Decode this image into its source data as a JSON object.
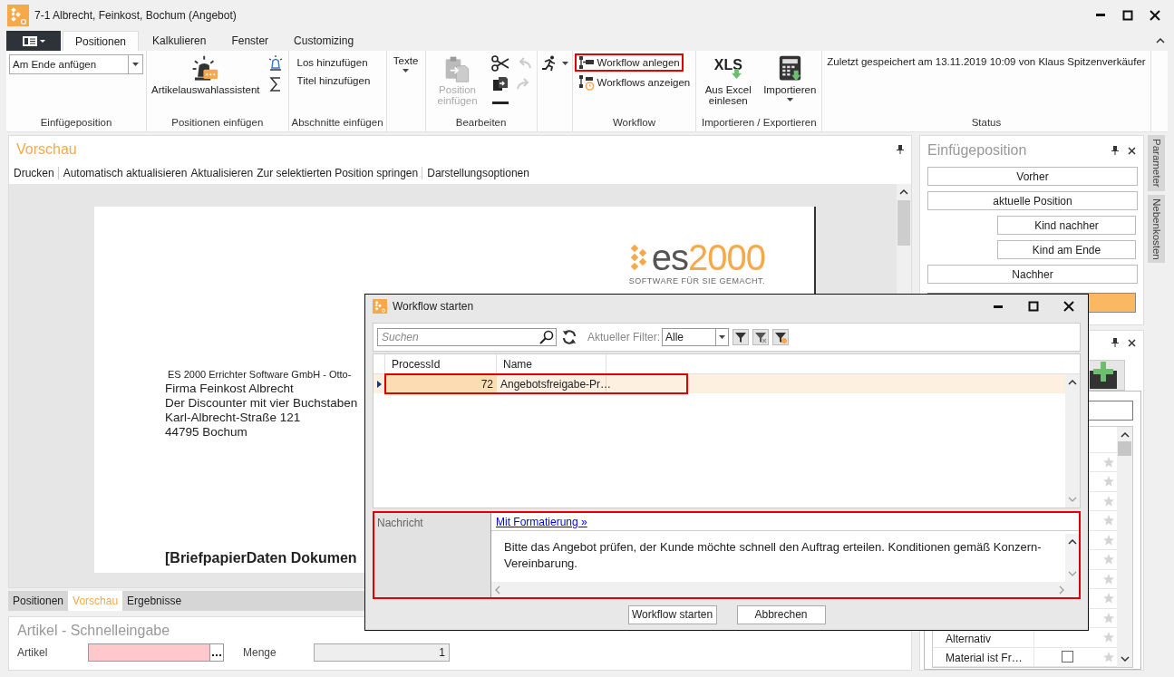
{
  "window": {
    "title": "7-1 Albrecht, Feinkost, Bochum (Angebot)"
  },
  "ribbon_tabs": [
    {
      "label": "Positionen",
      "selected": true
    },
    {
      "label": "Kalkulieren",
      "selected": false
    },
    {
      "label": "Fenster",
      "selected": false
    },
    {
      "label": "Customizing",
      "selected": false
    }
  ],
  "ribbon": {
    "groups": [
      {
        "label": "Einfügeposition",
        "columns": [
          [
            {
              "kind": "dropdown",
              "label": "Am Ende anfügen",
              "disabled": false,
              "highlighted": false
            }
          ]
        ]
      },
      {
        "label": "Positionen einfügen",
        "columns": [
          [
            {
              "kind": "large",
              "label": "Artikelauswahlassistent",
              "disabled": false,
              "highlighted": false
            }
          ],
          [
            {
              "kind": "icon",
              "disabled": false,
              "highlighted": false
            },
            {
              "kind": "icon",
              "disabled": false,
              "highlighted": false
            }
          ]
        ]
      },
      {
        "label": "Abschnitte einfügen",
        "columns": [
          [
            {
              "kind": "text",
              "label": "Los hinzufügen",
              "disabled": false,
              "highlighted": false
            },
            {
              "kind": "text",
              "label": "Titel hinzufügen",
              "disabled": false,
              "highlighted": false
            }
          ]
        ]
      },
      {
        "columns": [
          [
            {
              "kind": "large_menu",
              "label": "Texte",
              "disabled": false,
              "highlighted": false
            }
          ]
        ]
      },
      {
        "label": "Bearbeiten",
        "columns": [
          [
            {
              "kind": "large",
              "label": "Position einfügen",
              "disabled": true,
              "highlighted": false
            }
          ],
          [
            {
              "kind": "icon",
              "disabled": false,
              "highlighted": false
            },
            {
              "kind": "icon",
              "disabled": false,
              "highlighted": false
            },
            {
              "kind": "icon",
              "disabled": false,
              "highlighted": false
            }
          ],
          [
            {
              "kind": "icon",
              "disabled": true,
              "highlighted": false
            },
            {
              "kind": "icon",
              "disabled": true,
              "highlighted": false
            }
          ]
        ]
      },
      {
        "columns": [
          [
            {
              "kind": "icon_menu",
              "disabled": false,
              "highlighted": false
            }
          ]
        ]
      },
      {
        "label": "Workflow",
        "columns": [
          [
            {
              "kind": "small",
              "label": "Workflow anlegen",
              "disabled": false,
              "highlighted": true
            },
            {
              "kind": "small",
              "label": "Workflows anzeigen",
              "disabled": false,
              "highlighted": false
            }
          ]
        ]
      },
      {
        "label": "Importieren / Exportieren",
        "columns": [
          [
            {
              "kind": "large",
              "label": "Aus Excel einlesen",
              "icon_text": "XLS",
              "disabled": false,
              "highlighted": false
            }
          ],
          [
            {
              "kind": "large_menu",
              "label": "Importieren",
              "disabled": false,
              "highlighted": false
            }
          ]
        ]
      },
      {
        "label": "Status",
        "columns": [
          [
            {
              "kind": "info",
              "label": "Zuletzt gespeichert am 13.11.2019 10:09 von Klaus Spitzenverkäufer",
              "disabled": false,
              "highlighted": false
            }
          ]
        ]
      }
    ]
  },
  "preview": {
    "title": "Vorschau",
    "toolbar": [
      {
        "label": "Drucken",
        "separator_after": true
      },
      {
        "label": "Automatisch aktualisieren",
        "separator_after": false
      },
      {
        "label": "Aktualisieren",
        "separator_after": false
      },
      {
        "label": "Zur selektierten Position springen",
        "separator_after": true
      },
      {
        "label": "Darstellungsoptionen",
        "separator_after": false
      }
    ],
    "page": {
      "logo": {
        "part_1": "es",
        "part_2": "2000",
        "tagline": "SOFTWARE FÜR SIE GEMACHT."
      },
      "sender_line": "ES 2000 Errichter Software GmbH - Otto-",
      "address": [
        "Firma Feinkost Albrecht",
        "Der Discounter mit vier Buchstaben",
        "Karl-Albrecht-Straße 121",
        "44795 Bochum"
      ],
      "heading": "[BriefpapierDaten Dokumen"
    }
  },
  "bottom_tabs": [
    {
      "label": "Positionen",
      "selected": false
    },
    {
      "label": "Vorschau",
      "selected": true
    },
    {
      "label": "Ergebnisse",
      "selected": false
    }
  ],
  "quick_entry": {
    "title": "Artikel - Schnelleingabe",
    "fields": [
      {
        "kind": "lookup",
        "label": "Artikel",
        "invalid": true
      },
      {
        "kind": "number",
        "label": "Menge",
        "value": "1",
        "invalid": false
      }
    ]
  },
  "insert_panel": {
    "title": "Einfügeposition",
    "buttons": [
      {
        "label": "Vorher",
        "indented": false
      },
      {
        "label": "aktuelle Position",
        "indented": false
      },
      {
        "label": "Kind nachher",
        "indented": true
      },
      {
        "label": "Kind am Ende",
        "indented": true
      },
      {
        "label": "Nachher",
        "indented": false
      }
    ]
  },
  "side_tabs": [
    "Parameter",
    "Nebenkosten"
  ],
  "properties": {
    "rows": [
      {
        "favorite": false
      },
      {
        "favorite": false
      },
      {
        "favorite": false
      },
      {
        "favorite": false
      },
      {
        "favorite": false
      },
      {
        "favorite": false
      },
      {
        "favorite": false
      },
      {
        "favorite": false
      },
      {
        "favorite": false
      },
      {
        "label": "Alternativ",
        "favorite": false
      },
      {
        "label": "Material ist Fr…",
        "checked": false,
        "favorite": false
      }
    ]
  },
  "dialog": {
    "title": "Workflow starten",
    "search": {
      "placeholder": "Suchen"
    },
    "filter_label": "Aktueller Filter:",
    "filter_value": "Alle",
    "columns": [
      "ProcessId",
      "Name"
    ],
    "rows": [
      {
        "cells": [
          "72",
          "Angebotsfreigabe-Pr…"
        ],
        "selected": true,
        "highlighted": true
      }
    ],
    "message": {
      "label": "Nachricht",
      "link": "Mit Formatierung »",
      "text": "Bitte das Angebot prüfen, der Kunde möchte schnell den Auftrag erteilen. Konditionen gemäß Konzern-Vereinbarung.",
      "highlighted": true
    },
    "buttons": [
      "Workflow starten",
      "Abbrechen"
    ]
  }
}
